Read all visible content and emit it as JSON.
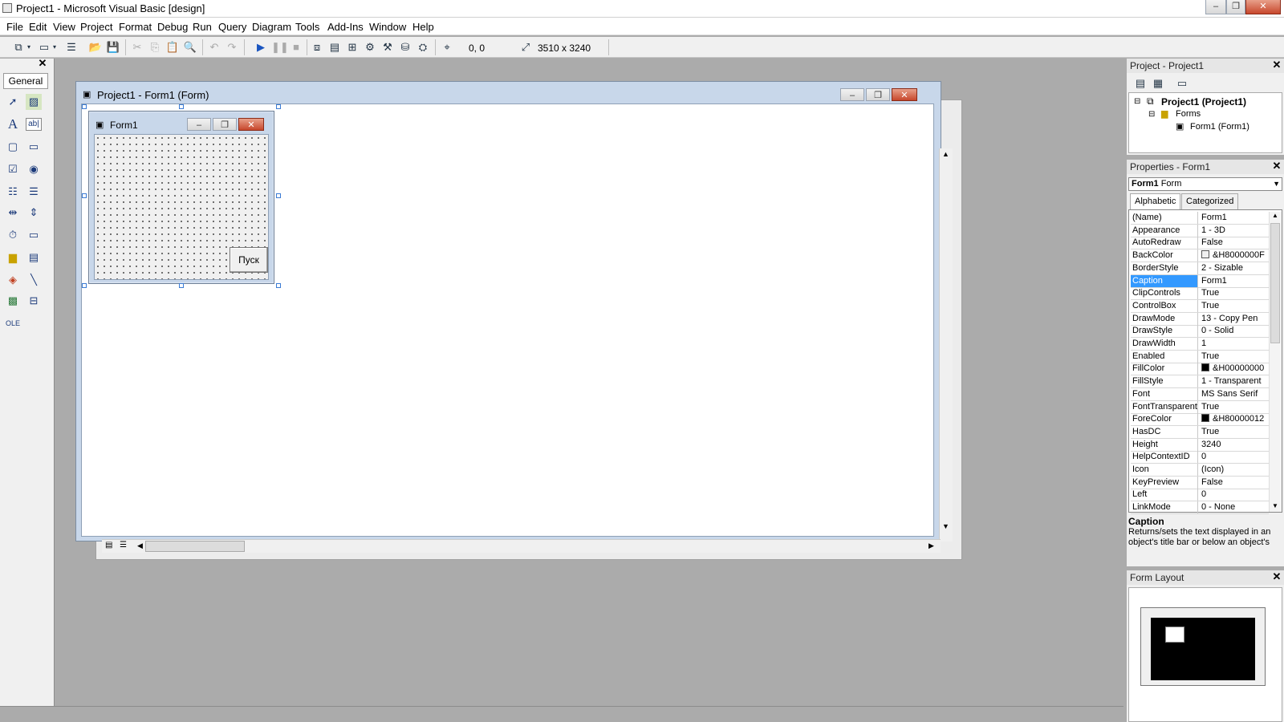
{
  "window": {
    "title": "Project1 - Microsoft Visual Basic [design]"
  },
  "menu": [
    "File",
    "Edit",
    "View",
    "Project",
    "Format",
    "Debug",
    "Run",
    "Query",
    "Diagram",
    "Tools",
    "Add-Ins",
    "Window",
    "Help"
  ],
  "toolbar": {
    "position": "0, 0",
    "size": "3510 x 3240"
  },
  "toolbox": {
    "tab": "General"
  },
  "designer": {
    "window_title": "Project1 - Form1 (Form)",
    "form_caption": "Form1",
    "button_caption": "Пуск"
  },
  "project_explorer": {
    "title": "Project - Project1",
    "root": "Project1 (Project1)",
    "folder": "Forms",
    "item": "Form1 (Form1)"
  },
  "properties": {
    "title": "Properties - Form1",
    "object_name": "Form1",
    "object_type": "Form",
    "tabs": [
      "Alphabetic",
      "Categorized"
    ],
    "selected": "Caption",
    "rows": [
      {
        "name": "(Name)",
        "value": "Form1"
      },
      {
        "name": "Appearance",
        "value": "1 - 3D"
      },
      {
        "name": "AutoRedraw",
        "value": "False"
      },
      {
        "name": "BackColor",
        "value": "&H8000000F",
        "swatch": "#f0f0f0"
      },
      {
        "name": "BorderStyle",
        "value": "2 - Sizable"
      },
      {
        "name": "Caption",
        "value": "Form1"
      },
      {
        "name": "ClipControls",
        "value": "True"
      },
      {
        "name": "ControlBox",
        "value": "True"
      },
      {
        "name": "DrawMode",
        "value": "13 - Copy Pen"
      },
      {
        "name": "DrawStyle",
        "value": "0 - Solid"
      },
      {
        "name": "DrawWidth",
        "value": "1"
      },
      {
        "name": "Enabled",
        "value": "True"
      },
      {
        "name": "FillColor",
        "value": "&H00000000",
        "swatch": "#000000"
      },
      {
        "name": "FillStyle",
        "value": "1 - Transparent"
      },
      {
        "name": "Font",
        "value": "MS Sans Serif"
      },
      {
        "name": "FontTransparent",
        "value": "True"
      },
      {
        "name": "ForeColor",
        "value": "&H80000012",
        "swatch": "#000000"
      },
      {
        "name": "HasDC",
        "value": "True"
      },
      {
        "name": "Height",
        "value": "3240"
      },
      {
        "name": "HelpContextID",
        "value": "0"
      },
      {
        "name": "Icon",
        "value": "(Icon)"
      },
      {
        "name": "KeyPreview",
        "value": "False"
      },
      {
        "name": "Left",
        "value": "0"
      },
      {
        "name": "LinkMode",
        "value": "0 - None"
      }
    ],
    "desc_title": "Caption",
    "desc_text": "Returns/sets the text displayed in an object's title bar or below an object's"
  },
  "form_layout": {
    "title": "Form Layout"
  },
  "colors": {
    "selection": "#3399ff",
    "mdi_frame": "#c8d7ea",
    "close_button": "#c7472c"
  }
}
